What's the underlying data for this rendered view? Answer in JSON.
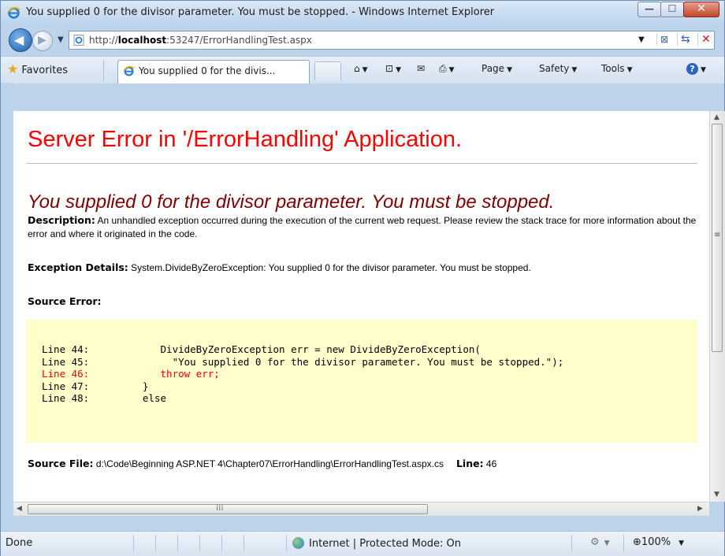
{
  "window": {
    "title": "You supplied 0 for the divisor parameter. You must be stopped. - Windows Internet Explorer",
    "minimize": "—",
    "maximize": "☐",
    "close": "✕"
  },
  "address": {
    "url_prefix": "http://",
    "url_host": "localhost",
    "url_rest": ":53247/ErrorHandlingTest.aspx"
  },
  "toolbar": {
    "favorites_label": "Favorites",
    "tab_title": "You supplied 0 for the divis...",
    "page_label": "Page",
    "safety_label": "Safety",
    "tools_label": "Tools"
  },
  "page": {
    "heading": "Server Error in '/ErrorHandling' Application.",
    "subheading": "You supplied 0 for the divisor parameter. You must be stopped.",
    "description_label": "Description:",
    "description_text": " An unhandled exception occurred during the execution of the current web request. Please review the stack trace for more information about the error and where it originated in the code.",
    "exception_label": "Exception Details:",
    "exception_text": " System.DivideByZeroException: You supplied 0 for the divisor parameter. You must be stopped.",
    "source_error_label": "Source Error:",
    "code_lines": [
      {
        "text": "Line 44:            DivideByZeroException err = new DivideByZeroException(",
        "error": false
      },
      {
        "text": "Line 45:              \"You supplied 0 for the divisor parameter. You must be stopped.\");",
        "error": false
      },
      {
        "text": "Line 46:            throw err;",
        "error": true
      },
      {
        "text": "Line 47:         }",
        "error": false
      },
      {
        "text": "Line 48:         else",
        "error": false
      }
    ],
    "source_file_label": "Source File:",
    "source_file_path": " d:\\Code\\Beginning ASP.NET 4\\Chapter07\\ErrorHandling\\ErrorHandlingTest.aspx.cs",
    "line_label": "Line:",
    "line_number": " 46"
  },
  "status": {
    "left_text": "Done",
    "zone_text": "Internet | Protected Mode: On",
    "zoom_text": "100%"
  },
  "colors": {
    "heading": "#ff0000",
    "subheading": "#800000",
    "code_background": "#ffffcc",
    "error_line": "#ff0000"
  }
}
